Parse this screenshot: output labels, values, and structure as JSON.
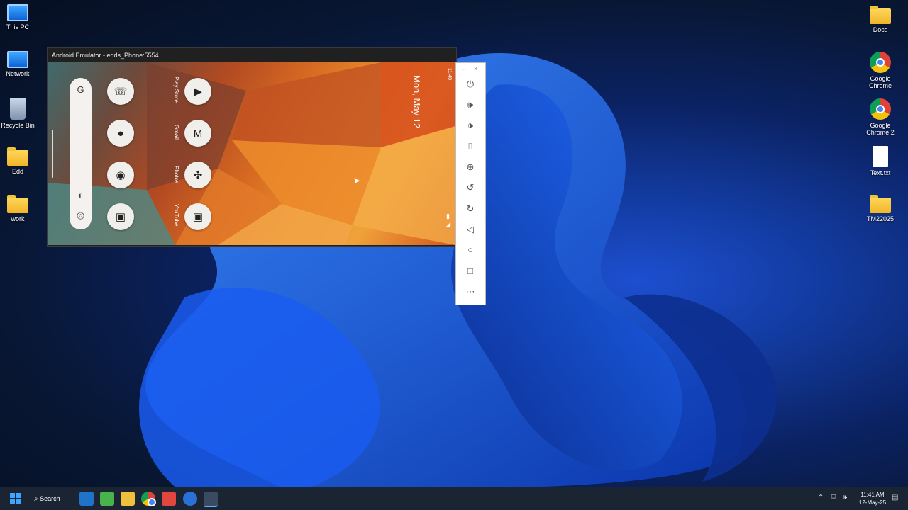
{
  "desktop": {
    "left_icons": [
      {
        "label": "This PC",
        "icon": "this-pc-icon"
      },
      {
        "label": "Network",
        "icon": "network-icon"
      },
      {
        "label": "Recycle Bin",
        "icon": "recycle-bin-icon"
      },
      {
        "label": "Edd",
        "icon": "folder-icon"
      },
      {
        "label": "work",
        "icon": "folder-icon"
      }
    ],
    "right_icons": [
      {
        "label": "Docs",
        "icon": "folder-icon"
      },
      {
        "label": "Google Chrome",
        "icon": "chrome-icon"
      },
      {
        "label": "Google Chrome 2",
        "icon": "chrome-icon"
      },
      {
        "label": "Text.txt",
        "icon": "text-file-icon"
      },
      {
        "label": "TM22025",
        "icon": "folder-icon"
      }
    ]
  },
  "emulator": {
    "title": "Android Emulator - edds_Phone:5554",
    "status_time": "11:40",
    "date": "Mon, May 12",
    "apps": [
      {
        "label": "Play Store",
        "icon": "play-store-icon"
      },
      {
        "label": "Gmail",
        "icon": "gmail-icon"
      },
      {
        "label": "Photos",
        "icon": "photos-icon"
      },
      {
        "label": "YouTube",
        "icon": "youtube-icon"
      }
    ],
    "dock_apps": [
      "phone-icon",
      "messages-icon",
      "chrome-icon",
      "camera-icon"
    ]
  },
  "toolbar": {
    "buttons": [
      "power-icon",
      "volume-up-icon",
      "volume-down-icon",
      "screenshot-icon",
      "zoom-icon",
      "rotate-left-icon",
      "rotate-right-icon",
      "back-icon",
      "home-icon",
      "overview-icon",
      "more-icon"
    ],
    "minimize": "–",
    "close": "×"
  },
  "taskbar": {
    "search_label": "Search",
    "time": "11:41 AM",
    "date": "12-May-25",
    "accent": "#0078d4"
  }
}
